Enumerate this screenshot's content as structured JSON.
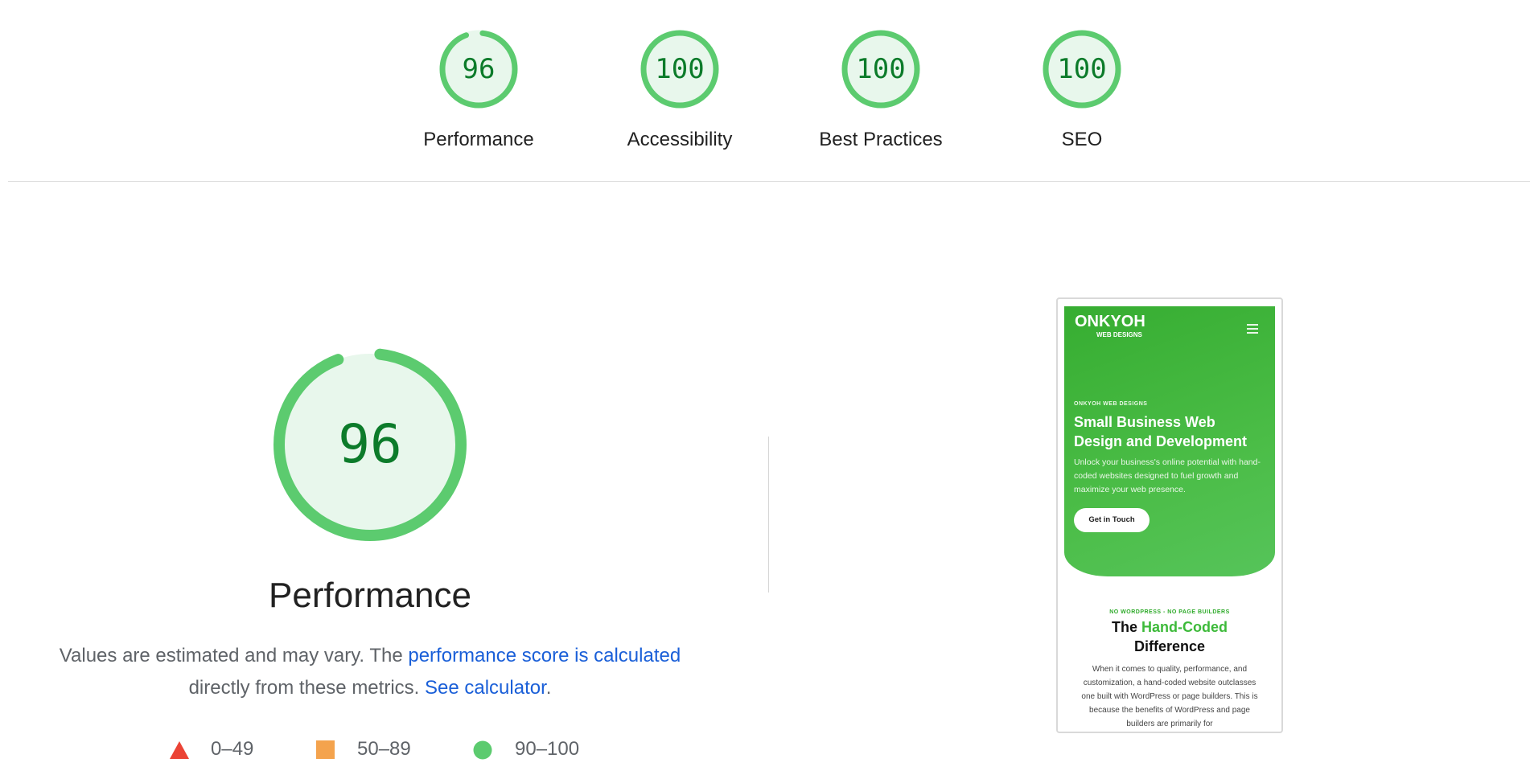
{
  "summary": {
    "categories": [
      {
        "score": "96",
        "label": "Performance",
        "fraction": 0.96,
        "color": "#0cce6b"
      },
      {
        "score": "100",
        "label": "Accessibility",
        "fraction": 1.0,
        "color": "#0cce6b"
      },
      {
        "score": "100",
        "label": "Best Practices",
        "fraction": 1.0,
        "color": "#0cce6b"
      },
      {
        "score": "100",
        "label": "SEO",
        "fraction": 1.0,
        "color": "#0cce6b"
      }
    ]
  },
  "performance": {
    "score": "96",
    "fraction": 0.96,
    "title": "Performance",
    "desc_prefix": "Values are estimated and may vary. The",
    "desc_link": "performance score is calculated",
    "desc_middle": "directly from these metrics.",
    "calc_link": "See calculator",
    "desc_suffix": "."
  },
  "legend": [
    {
      "range": "0–49",
      "shape": "triangle",
      "color": "#eb4335"
    },
    {
      "range": "50–89",
      "shape": "square",
      "color": "#f4a34d"
    },
    {
      "range": "90–100",
      "shape": "circle",
      "color": "#5ccb6f"
    }
  ],
  "colors": {
    "gauge_ring": "#5ccb6f",
    "gauge_fill": "#e8f7ec",
    "score_text": "#0c7b2a",
    "link": "#1a5fd8"
  },
  "screenshot": {
    "logo": "ONKYOH",
    "logo_sub": "WEB DESIGNS",
    "eyebrow": "ONKYOH WEB DESIGNS",
    "hero_title": "Small Business Web Design and Development",
    "hero_text": "Unlock your business's online potential with hand-coded websites designed to fuel growth and maximize your web presence.",
    "button": "Get in Touch",
    "sub_eyebrow": "NO WORDPRESS - NO PAGE BUILDERS",
    "sub_title_pre": "The",
    "sub_title_highlight": "Hand-Coded",
    "sub_title_post": "Difference",
    "sub_text": "When it comes to quality, performance, and customization, a hand-coded website outclasses one built with WordPress or page builders. This is because the benefits of WordPress and page builders are primarily for"
  }
}
